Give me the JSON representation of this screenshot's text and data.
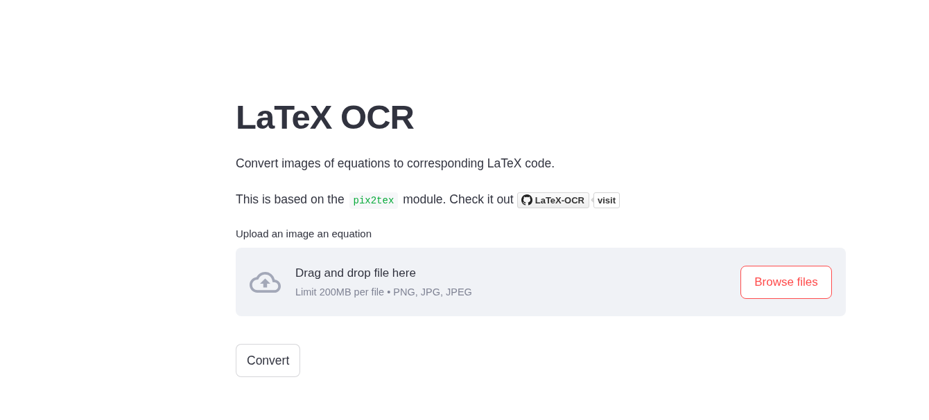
{
  "title": "LaTeX OCR",
  "description": "Convert images of equations to corresponding LaTeX code.",
  "source_line": {
    "before": "This is based on the",
    "code": "pix2tex",
    "after": "module. Check it out",
    "repo_badge": "LaTeX-OCR",
    "visit_badge": "visit"
  },
  "uploader": {
    "label": "Upload an image an equation",
    "prompt": "Drag and drop file here",
    "limits": "Limit 200MB per file • PNG, JPG, JPEG",
    "button": "Browse files"
  },
  "buttons": [
    "Convert"
  ]
}
